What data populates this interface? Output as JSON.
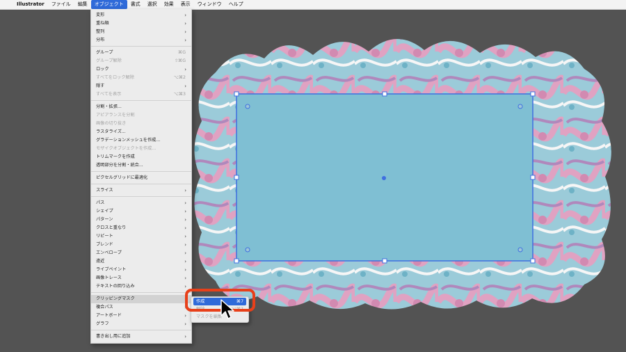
{
  "menubar": {
    "apple_icon": "apple-icon",
    "app_name": "Illustrator",
    "items": [
      "ファイル",
      "編集",
      "オブジェクト",
      "書式",
      "選択",
      "効果",
      "表示",
      "ウィンドウ",
      "ヘルプ"
    ]
  },
  "object_menu": {
    "items": [
      {
        "label": "変形",
        "submenu": true
      },
      {
        "label": "重ね順",
        "submenu": true
      },
      {
        "label": "整列",
        "submenu": true
      },
      {
        "label": "分布",
        "submenu": true
      },
      {
        "label": "グループ",
        "shortcut": "⌘G"
      },
      {
        "label": "グループ解除",
        "shortcut": "⇧⌘G",
        "disabled": true
      },
      {
        "label": "ロック",
        "submenu": true
      },
      {
        "label": "すべてをロック解除",
        "shortcut": "⌥⌘2",
        "disabled": true
      },
      {
        "label": "隠す",
        "submenu": true
      },
      {
        "label": "すべてを表示",
        "shortcut": "⌥⌘3",
        "disabled": true
      },
      {
        "label": "分割・拡張..."
      },
      {
        "label": "アピアランスを分割",
        "disabled": true
      },
      {
        "label": "画像の切り抜き",
        "disabled": true
      },
      {
        "label": "ラスタライズ..."
      },
      {
        "label": "グラデーションメッシュを作成..."
      },
      {
        "label": "モザイクオブジェクトを作成...",
        "disabled": true
      },
      {
        "label": "トリムマークを作成"
      },
      {
        "label": "透明部分を分割・統合..."
      },
      {
        "label": "ピクセルグリッドに最適化"
      },
      {
        "label": "スライス",
        "submenu": true
      },
      {
        "label": "パス",
        "submenu": true
      },
      {
        "label": "シェイプ",
        "submenu": true
      },
      {
        "label": "パターン",
        "submenu": true
      },
      {
        "label": "クロスと重なり",
        "submenu": true
      },
      {
        "label": "リピート",
        "submenu": true
      },
      {
        "label": "ブレンド",
        "submenu": true
      },
      {
        "label": "エンベロープ",
        "submenu": true
      },
      {
        "label": "遠近",
        "submenu": true
      },
      {
        "label": "ライブペイント",
        "submenu": true
      },
      {
        "label": "画像トレース",
        "submenu": true
      },
      {
        "label": "テキストの回り込み",
        "submenu": true
      },
      {
        "label": "クリッピングマスク",
        "submenu": true,
        "highlighted": true
      },
      {
        "label": "複合パス",
        "submenu": true
      },
      {
        "label": "アートボード",
        "submenu": true
      },
      {
        "label": "グラフ",
        "submenu": true
      },
      {
        "label": "書き出し用に追加",
        "submenu": true
      }
    ]
  },
  "clipping_mask_submenu": {
    "make": {
      "label": "作成",
      "shortcut": "⌘7"
    },
    "release": {
      "label": "解除",
      "shortcut": "⌥⌘7"
    },
    "edit": {
      "label": "マスクを編集"
    }
  },
  "colors": {
    "menu_highlight": "#2f6ad9",
    "callout": "#e8401a",
    "rectangle_fill": "#7fbfd3",
    "selection": "#3f6fe0",
    "canvas": "#535353"
  }
}
